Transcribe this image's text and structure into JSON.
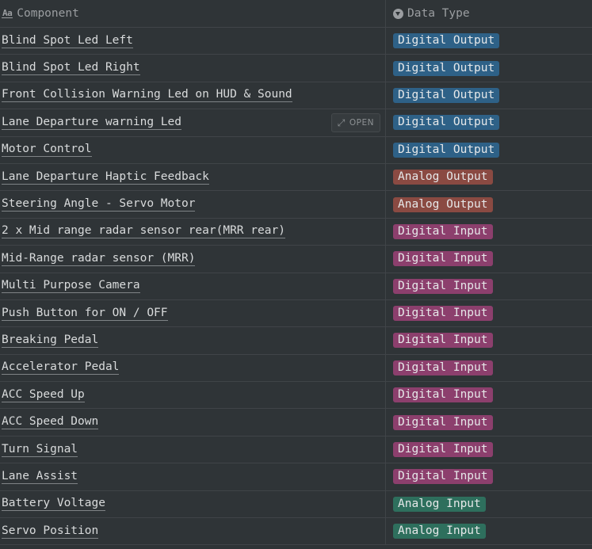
{
  "header": {
    "component_label": "Component",
    "component_icon": "text-property-icon",
    "datatype_label": "Data Type",
    "datatype_icon": "select-property-icon"
  },
  "open_button_label": "OPEN",
  "tag_colors": {
    "Digital Output": "#2e6187",
    "Analog Output": "#8a4a42",
    "Digital Input": "#8c3f6d",
    "Analog Input": "#2e6f5d"
  },
  "rows": [
    {
      "component": "Blind Spot Led Left",
      "data_type": "Digital Output"
    },
    {
      "component": "Blind Spot Led Right",
      "data_type": "Digital Output"
    },
    {
      "component": "Front Collision Warning Led on HUD & Sound",
      "data_type": "Digital Output"
    },
    {
      "component": "Lane Departure warning Led",
      "data_type": "Digital Output",
      "hovered": true
    },
    {
      "component": "Motor Control",
      "data_type": "Digital Output"
    },
    {
      "component": "Lane Departure Haptic Feedback",
      "data_type": "Analog Output"
    },
    {
      "component": "Steering Angle - Servo Motor",
      "data_type": "Analog Output"
    },
    {
      "component": "2 x Mid range radar sensor rear(MRR rear)",
      "data_type": "Digital Input"
    },
    {
      "component": "Mid-Range radar sensor (MRR)",
      "data_type": "Digital Input"
    },
    {
      "component": "Multi Purpose Camera",
      "data_type": "Digital Input"
    },
    {
      "component": "Push Button for ON / OFF",
      "data_type": "Digital Input"
    },
    {
      "component": "Breaking Pedal",
      "data_type": "Digital Input"
    },
    {
      "component": "Accelerator Pedal",
      "data_type": "Digital Input"
    },
    {
      "component": "ACC Speed Up",
      "data_type": "Digital Input"
    },
    {
      "component": "ACC Speed Down",
      "data_type": "Digital Input"
    },
    {
      "component": "Turn Signal",
      "data_type": "Digital Input"
    },
    {
      "component": "Lane Assist",
      "data_type": "Digital Input"
    },
    {
      "component": "Battery Voltage",
      "data_type": "Analog Input"
    },
    {
      "component": "Servo Position",
      "data_type": "Analog Input"
    }
  ]
}
